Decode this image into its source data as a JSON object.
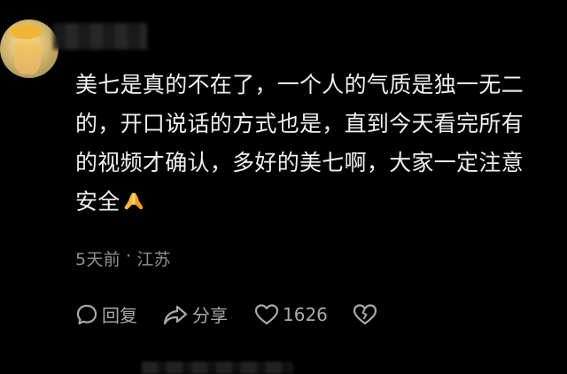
{
  "comment": {
    "text_lines": [
      "美七是真的不在了，一个人的气质是独一无二",
      "的，开口说话的方式也是，直到今天看完所有",
      "的视频才确认，多好的美七啊，大家一定注意",
      "安全"
    ],
    "emoji_icon": "folded-hands-icon",
    "time": "5天前",
    "separator": "·",
    "location": "江苏"
  },
  "actions": {
    "reply_label": "回复",
    "reply_icon": "speech-bubble-icon",
    "share_label": "分享",
    "share_icon": "share-arrow-icon",
    "like_count": "1626",
    "like_icon": "heart-icon",
    "dislike_icon": "broken-heart-icon"
  },
  "colors": {
    "background": "#000000",
    "text": "#f0f0f0",
    "meta": "#8f8f8f",
    "actions": "#a9a9a9"
  }
}
